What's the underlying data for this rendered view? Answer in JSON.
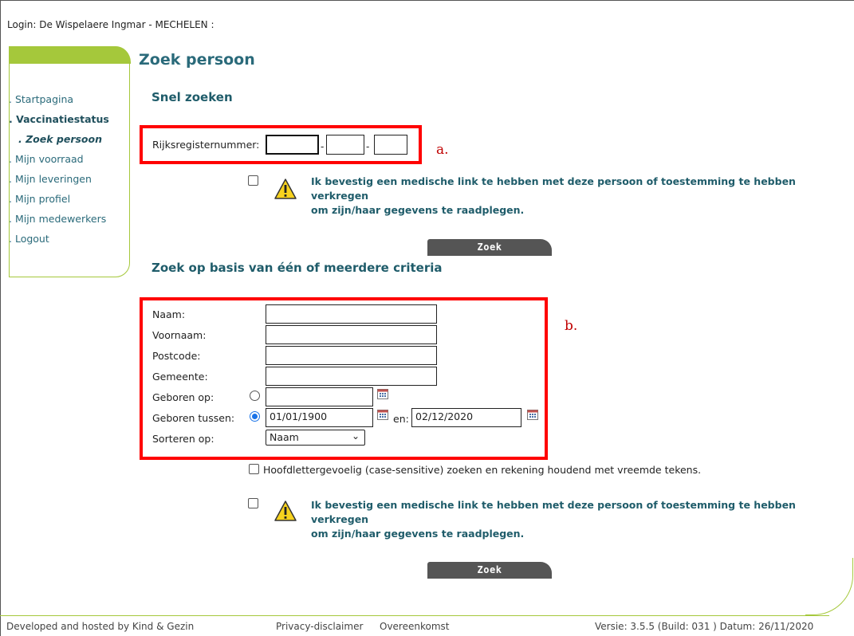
{
  "login": "Login: De Wispelaere Ingmar - MECHELEN  :",
  "sidebar": {
    "items": [
      {
        "label": ". Startpagina"
      },
      {
        "label": ". Vaccinatiestatus"
      },
      {
        "label": ". Zoek persoon"
      },
      {
        "label": ". Mijn voorraad"
      },
      {
        "label": ". Mijn leveringen"
      },
      {
        "label": ". Mijn profiel"
      },
      {
        "label": ". Mijn medewerkers"
      },
      {
        "label": ". Logout"
      }
    ]
  },
  "page_title": "Zoek persoon",
  "quick": {
    "heading": "Snel zoeken",
    "rrn_label": "Rijksregisternummer:",
    "dash": "-",
    "annotation": "a.",
    "confirm_text_1": "Ik bevestig een medische link te hebben met deze persoon of toestemming te hebben verkregen",
    "confirm_text_2": "om zijn/haar gegevens te raadplegen.",
    "search_button": "Zoek"
  },
  "criteria": {
    "heading": "Zoek op basis van één of meerdere criteria",
    "annotation": "b.",
    "naam_label": "Naam:",
    "voornaam_label": "Voornaam:",
    "postcode_label": "Postcode:",
    "gemeente_label": "Gemeente:",
    "geboren_op_label": "Geboren op:",
    "geboren_tussen_label": "Geboren tussen:",
    "from_date": "01/01/1900",
    "en_label": "en:",
    "to_date": "02/12/2020",
    "sort_label": "Sorteren op:",
    "sort_value": "Naam",
    "case_sensitive_label": "Hoofdlettergevoelig (case-sensitive) zoeken en rekening houdend met vreemde tekens.",
    "confirm_text_1": "Ik bevestig een medische link te hebben met deze persoon of toestemming te hebben verkregen",
    "confirm_text_2": "om zijn/haar gegevens te raadplegen.",
    "search_button": "Zoek"
  },
  "footer": {
    "developed": "Developed and hosted by Kind & Gezin",
    "privacy": "Privacy-disclaimer",
    "agreement": "Overeenkomst",
    "version": "Versie: 3.5.5 (Build: 031 ) Datum: 26/11/2020"
  },
  "colors": {
    "accent": "#a5c83b",
    "heading": "#2a6a7a",
    "annotation_box": "#ff0000"
  }
}
